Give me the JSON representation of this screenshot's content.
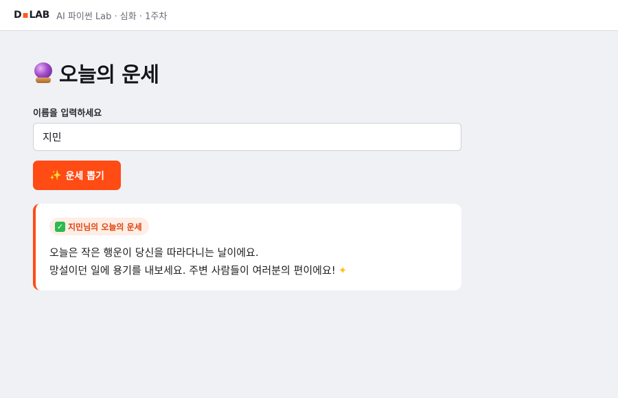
{
  "topbar": {
    "brand_left": "D",
    "brand_right": "LAB",
    "course": "AI 파이썬 Lab · 심화 · 1주차"
  },
  "page": {
    "title_icon": "crystal-ball-icon",
    "title": "오늘의 운세"
  },
  "form": {
    "name_label": "이름을 입력하세요",
    "name_value": "지민",
    "button_icon": "sparkles-icon",
    "button_label": "운세 뽑기"
  },
  "result": {
    "badge_icon": "check-mark-icon",
    "badge_text": "지민님의 오늘의 운세",
    "line1": "오늘은 작은 행운이 당신을 따라다니는 날이에요.",
    "line2": "망설이던 일에 용기를 내보세요. 주변 사람들이 여러분의 편이에요!",
    "line2_icon": "glowing-star-icon"
  },
  "colors": {
    "accent": "#ff4b14",
    "background": "#f0f1f5",
    "badge_bg": "#ffeee6",
    "check_green": "#2dbb4e"
  }
}
